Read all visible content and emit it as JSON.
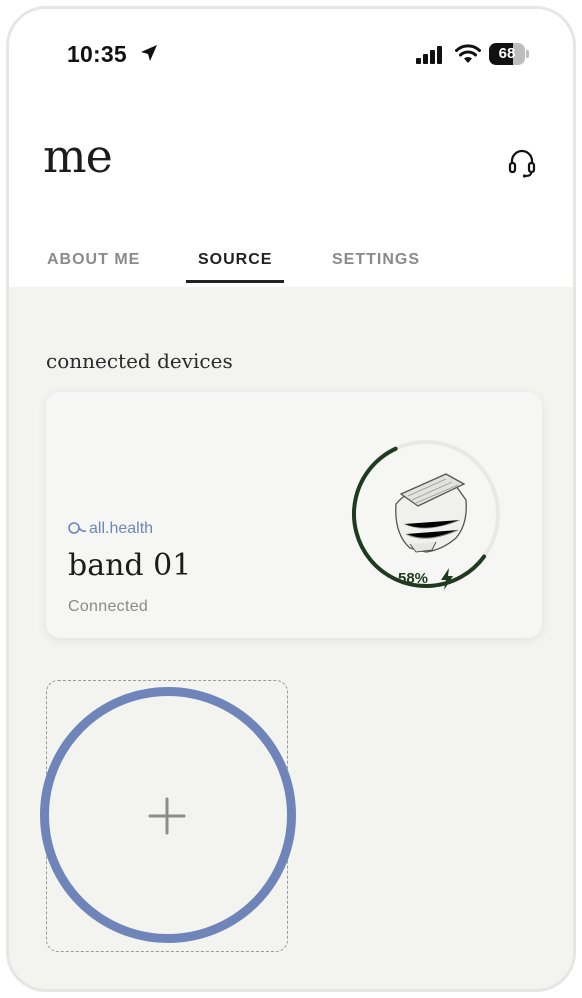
{
  "status_bar": {
    "time": "10:35",
    "battery_level": 68,
    "battery_text": "68",
    "icons": [
      "location-arrow-icon",
      "cellular-signal-icon",
      "wifi-icon",
      "battery-icon"
    ]
  },
  "header": {
    "title": "me",
    "support_icon": "headset-icon"
  },
  "tabs": [
    {
      "label": "ABOUT ME",
      "active": false
    },
    {
      "label": "SOURCE",
      "active": true
    },
    {
      "label": "SETTINGS",
      "active": false
    }
  ],
  "section": {
    "title": "connected devices"
  },
  "device": {
    "brand": "all.health",
    "name": "band 01",
    "status": "Connected",
    "battery_percent_text": "58%",
    "battery_fraction": 0.58,
    "charging": true,
    "image_icon": "band-device-icon"
  },
  "add_device": {
    "icon": "plus-icon"
  },
  "colors": {
    "accent": "#6f84b8",
    "ring": "#1f3a1f",
    "background": "#f3f3f0",
    "brand": "#6f86b8"
  }
}
